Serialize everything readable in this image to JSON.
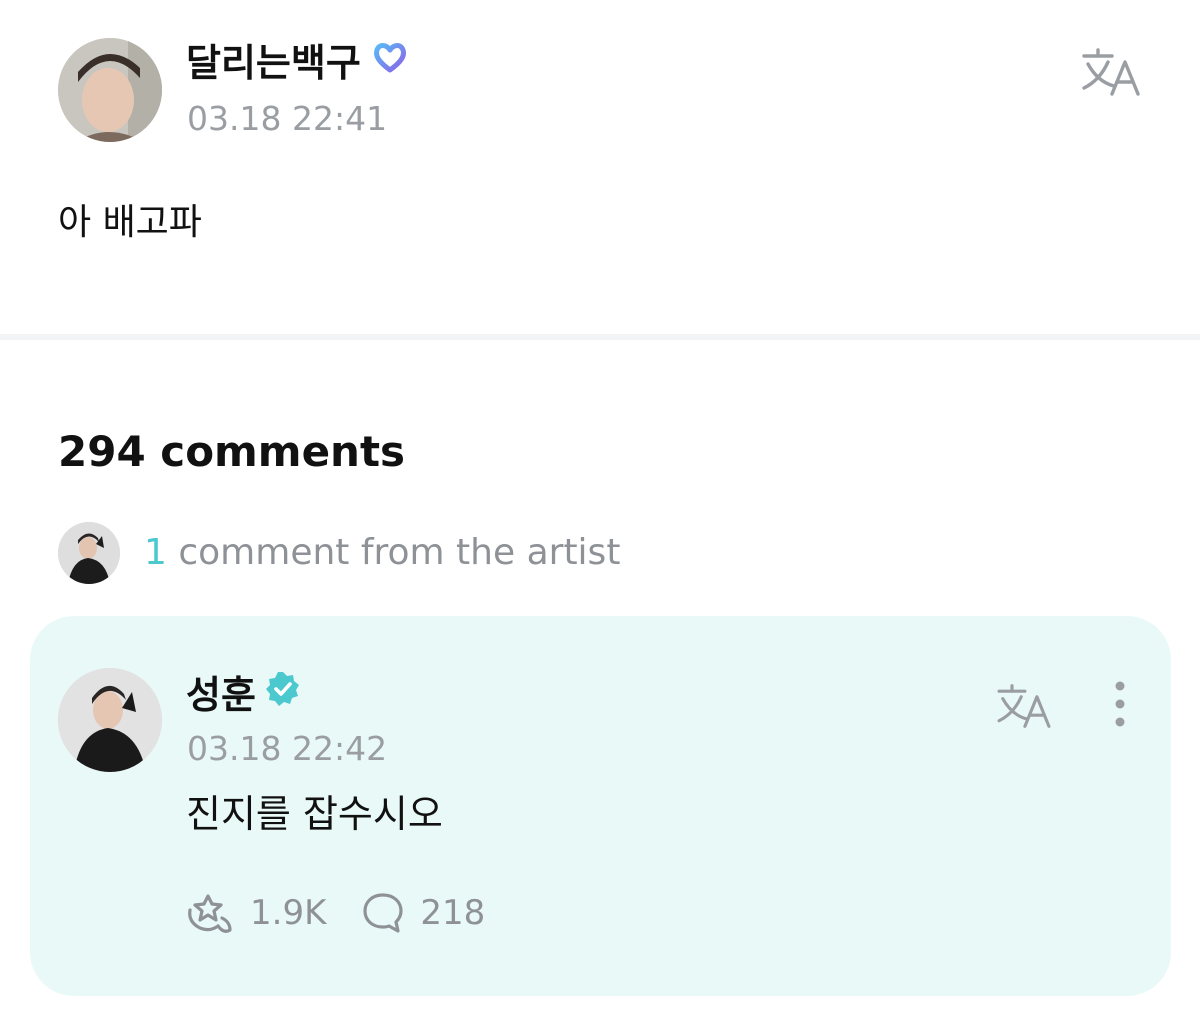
{
  "post": {
    "author": "달리는백구",
    "timestamp": "03.18 22:41",
    "body": "아 배고파",
    "badge_icon": "membership-badge-icon",
    "translate_icon": "translate-icon"
  },
  "comments": {
    "count_label": "294 comments",
    "artist_summary": {
      "count": "1",
      "label": "comment from the artist"
    },
    "items": [
      {
        "author": "성훈",
        "timestamp": "03.18 22:42",
        "body": "진지를 잡수시오",
        "likes": "1.9K",
        "replies": "218",
        "badge_icon": "verified-badge-icon"
      }
    ]
  },
  "colors": {
    "accent": "#4cc8cf",
    "card_bg": "#e9f9f7",
    "muted_text": "#9a9ea3"
  }
}
